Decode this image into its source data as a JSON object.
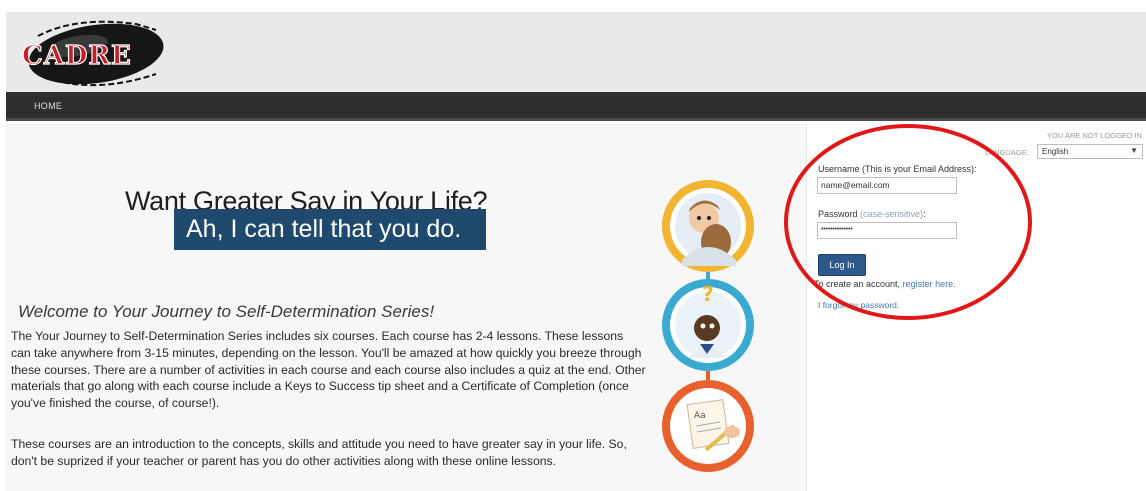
{
  "nav": {
    "home": "HOME"
  },
  "hero": {
    "title": "Want Greater Say in Your Life?",
    "subtitle": "Ah, I can tell that you do."
  },
  "intro": {
    "heading": "Welcome to Your Journey to Self-Determination Series!",
    "paragraph1": "The Your Journey to Self-Determination Series includes six courses.  Each course has 2-4 lessons.  These lessons can take anywhere from 3-15 minutes, depending on the lesson. You'll be amazed at how quickly you breeze through these courses.  There are a number of activities in each course and each course also includes a quiz at the end.  Other materials that go along with each course include a Keys to Success tip sheet and a Certificate of Completion (once you've finished the course, of course!).",
    "paragraph2": "These courses are an introduction to the concepts, skills and attitude you need to have greater say in your life. So, don't be suprized if your teacher or parent has you do other activities along with these online lessons."
  },
  "login": {
    "status": "YOU ARE NOT LOGGED IN.",
    "language_label": "LANGUAGE:",
    "language_value": "English",
    "username_label": "Username (This is your Email Address):",
    "username_value": "name@email.com",
    "password_label": "Password",
    "password_hint": "(case-sensitive)",
    "password_colon": ":",
    "password_value": "••••••••••••••",
    "login_button": "Log In",
    "create_prefix": "To create an account, ",
    "create_link": "register here.",
    "forgot_link": "I forgot my password."
  },
  "colors": {
    "nav_bg": "#2e2e2e",
    "hero_box": "#1f4a6e",
    "button": "#2d5a8a",
    "link": "#3f79b5",
    "annotation": "#e11818",
    "circle_yellow": "#f2b531",
    "circle_teal": "#3aaad1",
    "circle_orange": "#e8602c"
  },
  "icons": [
    "cadre-logo",
    "person-avatar-icon",
    "question-avatar-icon",
    "writing-avatar-icon",
    "chevron-down-icon"
  ]
}
